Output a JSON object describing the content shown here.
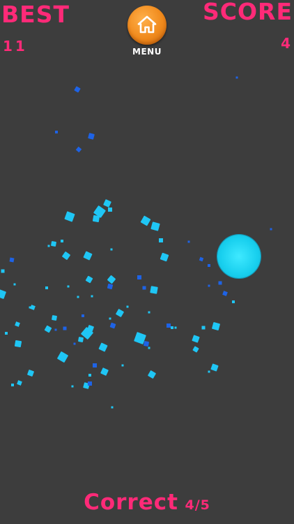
{
  "hud": {
    "best_label": "BEST",
    "best_value": "11",
    "score_label": "SCORE",
    "score_value": "4"
  },
  "menu": {
    "label": "MENU",
    "icon": "home-icon"
  },
  "status": {
    "word": "Correct",
    "count": "4/5"
  },
  "colors": {
    "background": "#3d3d3d",
    "accent": "#ff2a78",
    "particle_light": "#1fc6f5",
    "particle_dark": "#1e63e6",
    "ball": "#18cfee",
    "menu_button": "#f08a1c"
  }
}
